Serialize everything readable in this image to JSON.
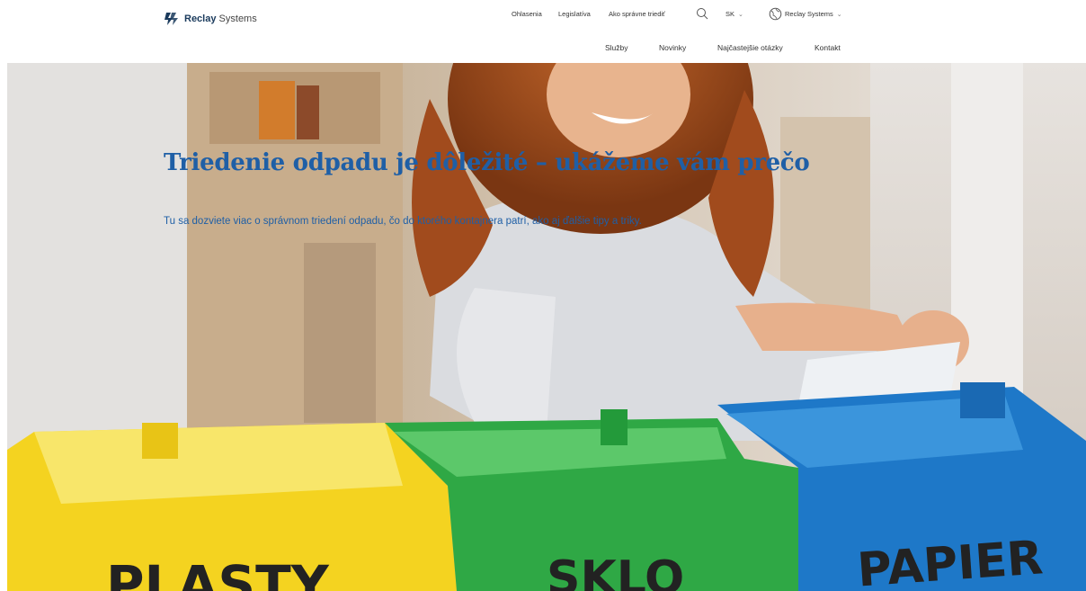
{
  "brand": {
    "name_bold": "Reclay",
    "name_rest": "Systems"
  },
  "top_nav": {
    "items": [
      "Ohlasenia",
      "Legislatíva",
      "Ako správne triediť"
    ],
    "language": "SK",
    "company": "Reclay Systems"
  },
  "main_nav": {
    "items": [
      "Služby",
      "Novinky",
      "Najčastejšie otázky",
      "Kontakt"
    ]
  },
  "hero": {
    "title": "Triedenie odpadu je dôležité – ukážeme vám prečo",
    "subtitle": "Tu sa dozviete viac o správnom triedení odpadu, čo do ktorého kontajnera patrí, ako aj ďalšie tipy a triky."
  },
  "bags": [
    {
      "label": "PLASTY",
      "color": "#f7d51f"
    },
    {
      "label": "SKLO",
      "color": "#37b34a"
    },
    {
      "label": "PAPIER",
      "color": "#1f7fd0"
    }
  ],
  "colors": {
    "accent": "#1f5fa6",
    "logo": "#1a3a5c"
  }
}
